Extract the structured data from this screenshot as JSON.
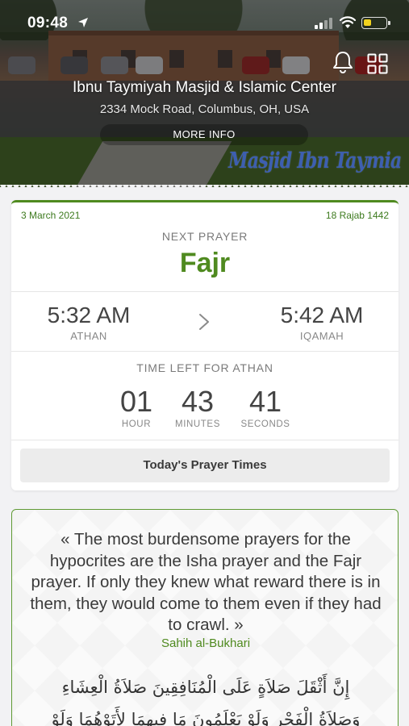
{
  "status": {
    "time": "09:48",
    "icons": [
      "location-arrow-icon",
      "cellular-signal-icon",
      "wifi-icon",
      "battery-icon"
    ],
    "battery_color": "#f1d21e"
  },
  "header": {
    "mosque_name": "Ibnu Taymiyah Masjid & Islamic Center",
    "address": "2334 Mock Road, Columbus, OH, USA",
    "more_info_label": "MORE INFO",
    "watermark": "Masjid Ibn Taymia",
    "icons": [
      "bell-icon",
      "grid-icon"
    ]
  },
  "prayer_card": {
    "gregorian_date": "3 March 2021",
    "hijri_date": "18 Rajab 1442",
    "next_prayer_label": "NEXT PRAYER",
    "next_prayer_name": "Fajr",
    "athan_time": "5:32 AM",
    "athan_label": "ATHAN",
    "iqamah_time": "5:42 AM",
    "iqamah_label": "IQAMAH",
    "time_left_label": "TIME LEFT FOR ATHAN",
    "countdown": {
      "hours": "01",
      "hours_label": "HOUR",
      "minutes": "43",
      "minutes_label": "MINUTES",
      "seconds": "41",
      "seconds_label": "SECONDS"
    },
    "todays_times_button": "Today's Prayer Times",
    "accent_color": "#4f8a1f"
  },
  "hadith": {
    "text": "« The most burdensome prayers for the hypocrites are the Isha prayer and the Fajr prayer. If only they knew what reward there is in them, they would come to them even if they had to crawl. »",
    "source": "Sahih al-Bukhari",
    "arabic_line_1": "إِنَّ أَثْقَلَ صَلاَةٍ عَلَى الْمُنَافِقِينَ صَلاَةُ الْعِشَاءِ",
    "arabic_line_2": "وَصَلاَةُ الْفَجْرِ وَلَوْ يَعْلَمُونَ مَا فِيهِمَا لأَتَوْهُمَا وَلَوْ"
  }
}
